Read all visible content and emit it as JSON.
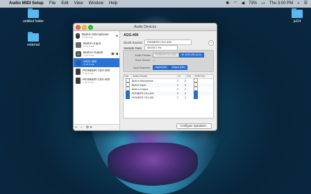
{
  "menubar": {
    "app_name": "Audio MIDI Setup",
    "menus": [
      "File",
      "Edit",
      "View",
      "Window",
      "Help"
    ],
    "status_items": {
      "battery": "73%",
      "datetime": "Thu 3:00 PM"
    }
  },
  "desktop": {
    "icons": [
      {
        "label": "untitled folder"
      },
      {
        "label": "external"
      },
      {
        "label": "jul14"
      }
    ]
  },
  "window": {
    "title": "Audio Devices",
    "sidebar": {
      "devices": [
        {
          "name": "Built-in Microphone",
          "sub": "2 in/ 0 out",
          "icon": "microphone-icon",
          "indicator": "●"
        },
        {
          "name": "Built-in Input",
          "sub": "2 in/ 0 out",
          "icon": "input-icon",
          "indicator": ""
        },
        {
          "name": "Built-in Output",
          "sub": "0 in/ 2 out",
          "icon": "speaker-icon",
          "indicator": "▣ ◀"
        },
        {
          "name": "AGG-400",
          "sub": "4 in/ 4 out",
          "icon": "aggregate-device-icon",
          "indicator": ""
        },
        {
          "name": "PIONEER CDJ-400",
          "sub": "2 in/ 2 out",
          "icon": "usb-device-icon",
          "indicator": ""
        },
        {
          "name": "PIONEER CDJ-400",
          "sub": "2 in/ 2 out",
          "icon": "usb-device-icon",
          "indicator": ""
        }
      ],
      "bottom_buttons": [
        "+",
        "−",
        "⚙ ▾"
      ]
    },
    "detail": {
      "device_title": "AGG-400",
      "clock_source_label": "Clock Source:",
      "clock_source_value": "PIONEER CDJ-400",
      "sample_rate_label": "Sample Rate:",
      "sample_rate_value": "44100.0 Hz",
      "help": "?",
      "format_rows": [
        {
          "label": "Audio Format:",
          "left": "PIONEER CDJ-400",
          "right": "ID: AGG-400 (4 in)"
        },
        {
          "label": "Clock Source:",
          "value": "—"
        },
        {
          "label": "Input Channels:",
          "left": "Input (Clk)",
          "right": "Output (Clk)"
        }
      ],
      "table": {
        "headers": [
          "Use",
          "Audio Device",
          "In",
          "Out",
          "Drift Corr."
        ],
        "rows": [
          {
            "use": false,
            "device": "Built-in Microphone",
            "in": "2",
            "out": "0",
            "drift": false
          },
          {
            "use": false,
            "device": "Built-in Input",
            "in": "2",
            "out": "0",
            "drift": false
          },
          {
            "use": false,
            "device": "Built-in Output",
            "in": "0",
            "out": "2",
            "drift": false
          },
          {
            "use": true,
            "device": "PIONEER CDJ-400",
            "in": "2",
            "out": "2",
            "drift": true
          },
          {
            "use": true,
            "device": "PIONEER CDJ-400",
            "in": "2",
            "out": "2",
            "drift": true
          }
        ]
      },
      "configure_button": "Configure Speakers..."
    }
  }
}
